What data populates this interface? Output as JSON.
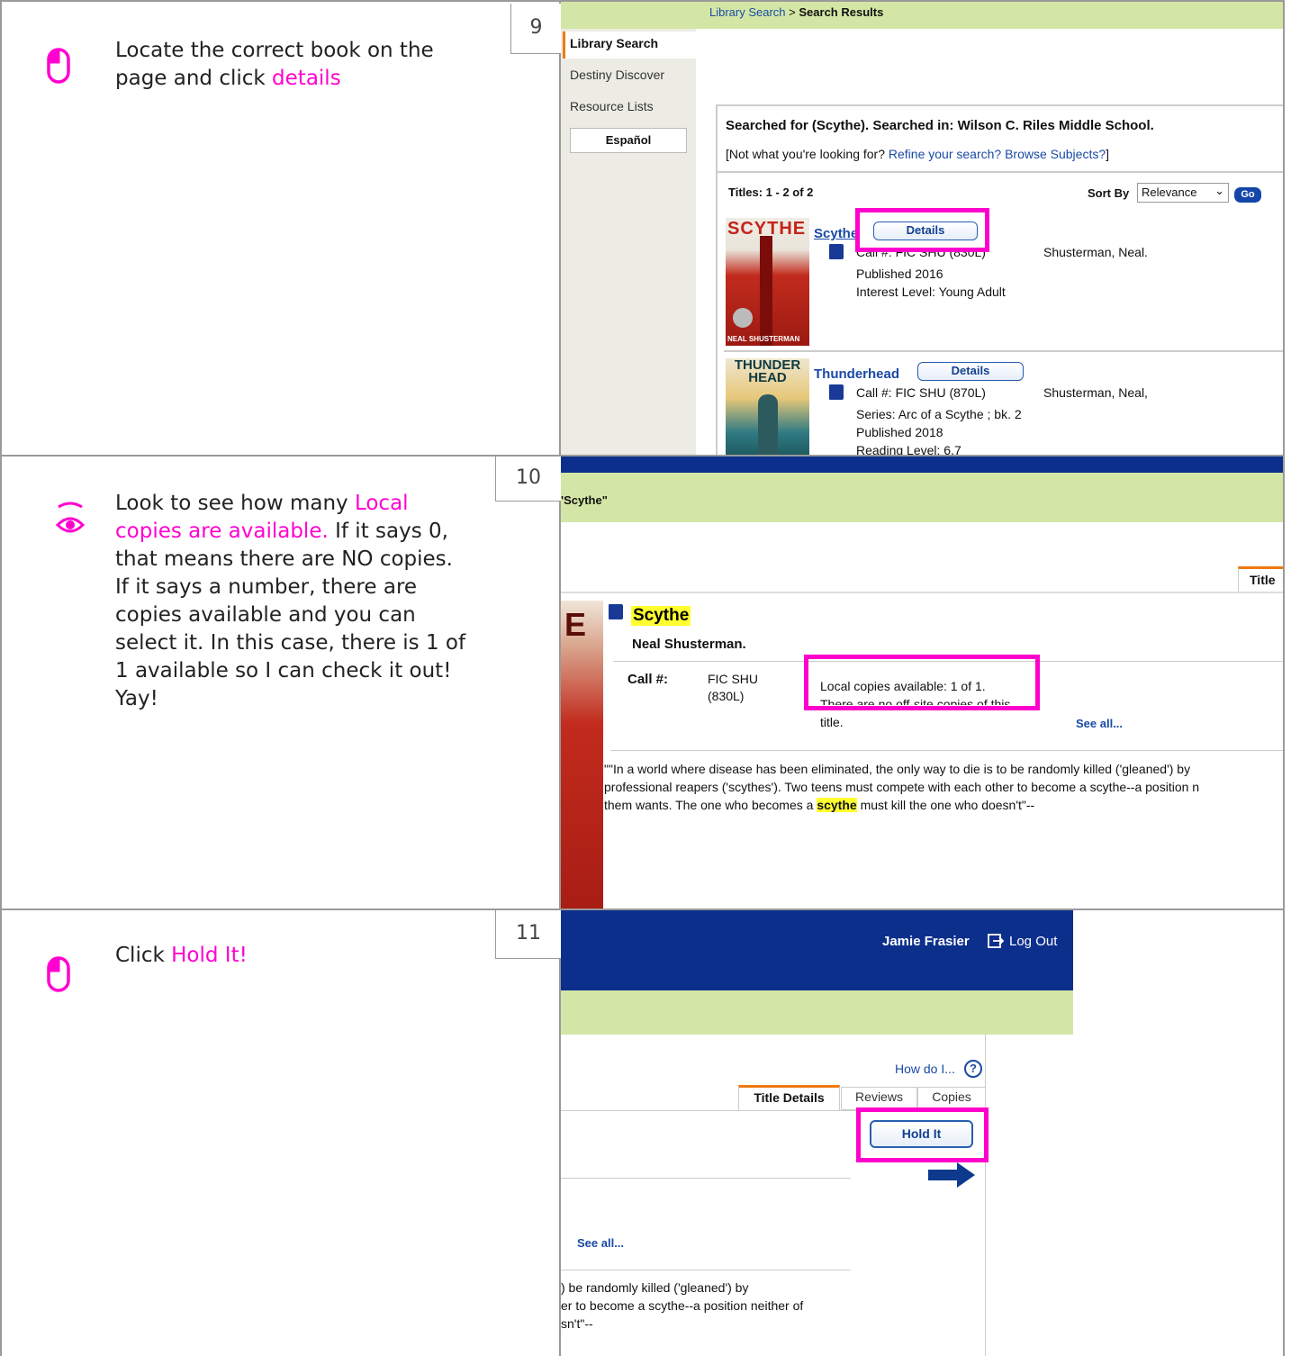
{
  "steps": [
    {
      "number": "9",
      "icon": "mouse-icon",
      "text_before": "Locate the correct book on the page and click ",
      "text_highlight": "details",
      "text_after": ""
    },
    {
      "number": "10",
      "icon": "eye-icon",
      "text_before": "Look to see how many ",
      "text_highlight": "Local copies are available.",
      "text_after": " If it says 0, that means there are NO copies. If it says a number, there are copies available and you can select it. In this case, there is 1 of 1 available so I can check it out! Yay!"
    },
    {
      "number": "11",
      "icon": "mouse-icon",
      "text_before": "Click ",
      "text_highlight": "Hold It!",
      "text_after": ""
    }
  ],
  "shot1": {
    "breadcrumb_link": "Library Search",
    "breadcrumb_sep": " > ",
    "breadcrumb_current": "Search Results",
    "sidebar": [
      "Library Search",
      "Destiny Discover",
      "Resource Lists"
    ],
    "lang_button": "Español",
    "searched_for": "Searched for (Scythe). Searched in: Wilson C. Riles Middle School.",
    "not_looking_prefix": "[Not what you're looking for? ",
    "refine_link": "Refine your search?",
    "browse_link": "Browse Subjects?",
    "not_looking_suffix": "]",
    "titles_count": "Titles: 1 - 2 of 2",
    "sort_by_label": "Sort By",
    "sort_value": "Relevance",
    "go_button": "Go",
    "results": [
      {
        "cover_title": "SCYTHE",
        "cover_author": "NEAL SHUSTERMAN",
        "title": "Scythe",
        "details": "Details",
        "call": "Call #: FIC SHU (830L)",
        "author": "Shusterman, Neal.",
        "lines": [
          "Published 2016",
          "Interest Level: Young Adult"
        ]
      },
      {
        "cover_title": "THUNDER HEAD",
        "title": "Thunderhead",
        "details": "Details",
        "call": "Call #: FIC SHU (870L)",
        "author": "Shusterman, Neal,",
        "lines": [
          "Series: Arc of a Scythe ; bk. 2",
          "Published 2018",
          "Reading Level: 6.7"
        ]
      }
    ]
  },
  "shot2": {
    "heading_fragment": "'Scythe\"",
    "tab": "Title",
    "title": "Scythe",
    "author": "Neal Shusterman.",
    "call_label": "Call #:",
    "call_value_1": "FIC SHU",
    "call_value_2": "(830L)",
    "local_copies": "Local copies available: 1 of 1.",
    "off_site": "There are no off-site copies of this",
    "off_site_end": "title.",
    "see_all": "See all...",
    "summary_1": "\"\"In a world where disease has been eliminated, the only way to die is to be randomly killed ('gleaned') by",
    "summary_2": "professional reapers ('scythes'). Two teens must compete with each other to become a scythe--a position n",
    "summary_3_pre": "them wants. The one who becomes a ",
    "summary_3_hl": "scythe",
    "summary_3_post": " must kill the one who doesn't\"--"
  },
  "shot3": {
    "user": "Jamie Frasier",
    "logout": "Log Out",
    "how_do_i": "How do I...",
    "tabs": [
      "Title Details",
      "Reviews",
      "Copies"
    ],
    "hold_button": "Hold It",
    "see_all": "See all...",
    "summary_1": ") be randomly killed ('gleaned') by",
    "summary_2": "er to become a scythe--a position neither of",
    "summary_3": "sn't\"--"
  },
  "colors": {
    "accent": "#ff00d0",
    "nav_blue": "#0d2f8c",
    "green_bar": "#d4e6a5"
  }
}
